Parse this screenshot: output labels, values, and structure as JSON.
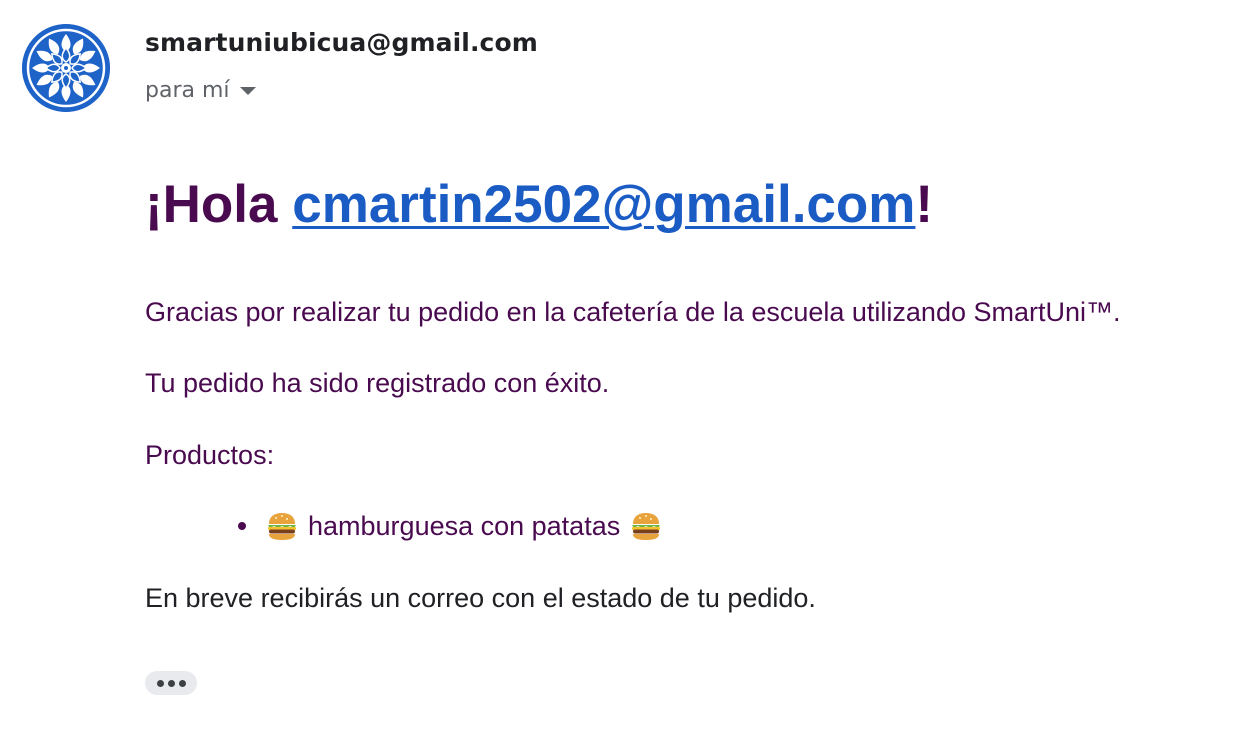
{
  "sender": {
    "email": "smartuniubicua@gmail.com",
    "avatar_icon": "mandala-icon",
    "avatar_color": "#1e63c8"
  },
  "recipient": {
    "label": "para mí",
    "dropdown_icon": "caret-down-icon"
  },
  "message": {
    "greeting_prefix": "¡Hola ",
    "greeting_email": "cmartin2502@gmail.com",
    "greeting_suffix": "!",
    "thanks": "Gracias por realizar tu pedido en la cafetería de la escuela utilizando SmartUni™.",
    "registered": "Tu pedido ha sido registrado con éxito.",
    "products_label": "Productos:",
    "products": [
      {
        "name": "hamburguesa con patatas",
        "icon": "hamburger-icon"
      }
    ],
    "closing": "En breve recibirás un correo con el estado de tu pedido."
  },
  "colors": {
    "heading": "#4a0a4f",
    "link": "#1a5bc4",
    "body_text": "#202124",
    "muted": "#5f6368"
  },
  "more_button_icon": "more-horizontal-icon"
}
